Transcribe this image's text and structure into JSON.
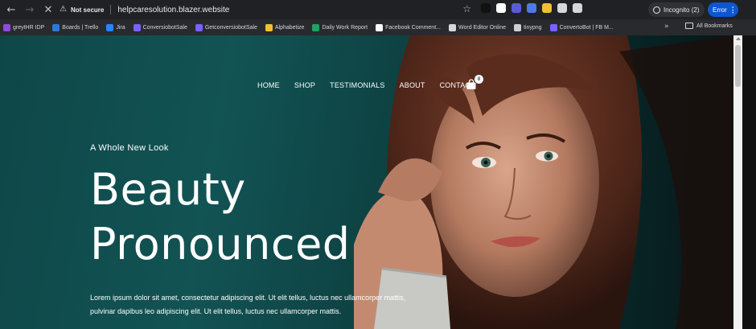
{
  "browser": {
    "not_secure": "Not secure",
    "url": "helpcaresolution.blazer.website",
    "incognito_label": "Incognito (2)",
    "error_label": "Error",
    "extensions": [
      "#111111",
      "#ffffff",
      "#5b5bd6",
      "#4d7ae8",
      "#f2c12e",
      "#d5d7da",
      "#d5d7da"
    ],
    "bookmarks": [
      {
        "label": "greytHR IDP",
        "color": "#8e4ad8"
      },
      {
        "label": "Boards | Trello",
        "color": "#2a7ad8"
      },
      {
        "label": "Jira",
        "color": "#2684ff"
      },
      {
        "label": "ConversiobotSale",
        "color": "#7b61ff"
      },
      {
        "label": "GetconversiobotSale",
        "color": "#7b61ff"
      },
      {
        "label": "Alphabetize",
        "color": "#f2c12e"
      },
      {
        "label": "Daily Work Report",
        "color": "#1ea362"
      },
      {
        "label": "Facebook Comment...",
        "color": "#ffffff"
      },
      {
        "label": "Word Editor Online",
        "color": "#d5d7da"
      },
      {
        "label": "tinypng",
        "color": "#cfcfcf"
      },
      {
        "label": "ConvertoBot | FB M...",
        "color": "#7b61ff"
      }
    ],
    "all_bookmarks": "All Bookmarks"
  },
  "site": {
    "nav": [
      "HOME",
      "SHOP",
      "TESTIMONIALS",
      "ABOUT",
      "CONTACT"
    ],
    "cart_count": "0",
    "eyebrow": "A Whole New Look",
    "headline_line1": "Beauty",
    "headline_line2": "Pronounced",
    "body_line1": "Lorem ipsum dolor sit amet, consectetur adipiscing elit. Ut elit tellus, luctus nec ullamcorper mattis,",
    "body_line2": "pulvinar dapibus leo adipiscing elit. Ut elit tellus, luctus nec ullamcorper mattis."
  },
  "colors": {
    "accent_teal": "#125354",
    "chrome_dark": "#202124",
    "error_blue": "#0b57d0"
  }
}
